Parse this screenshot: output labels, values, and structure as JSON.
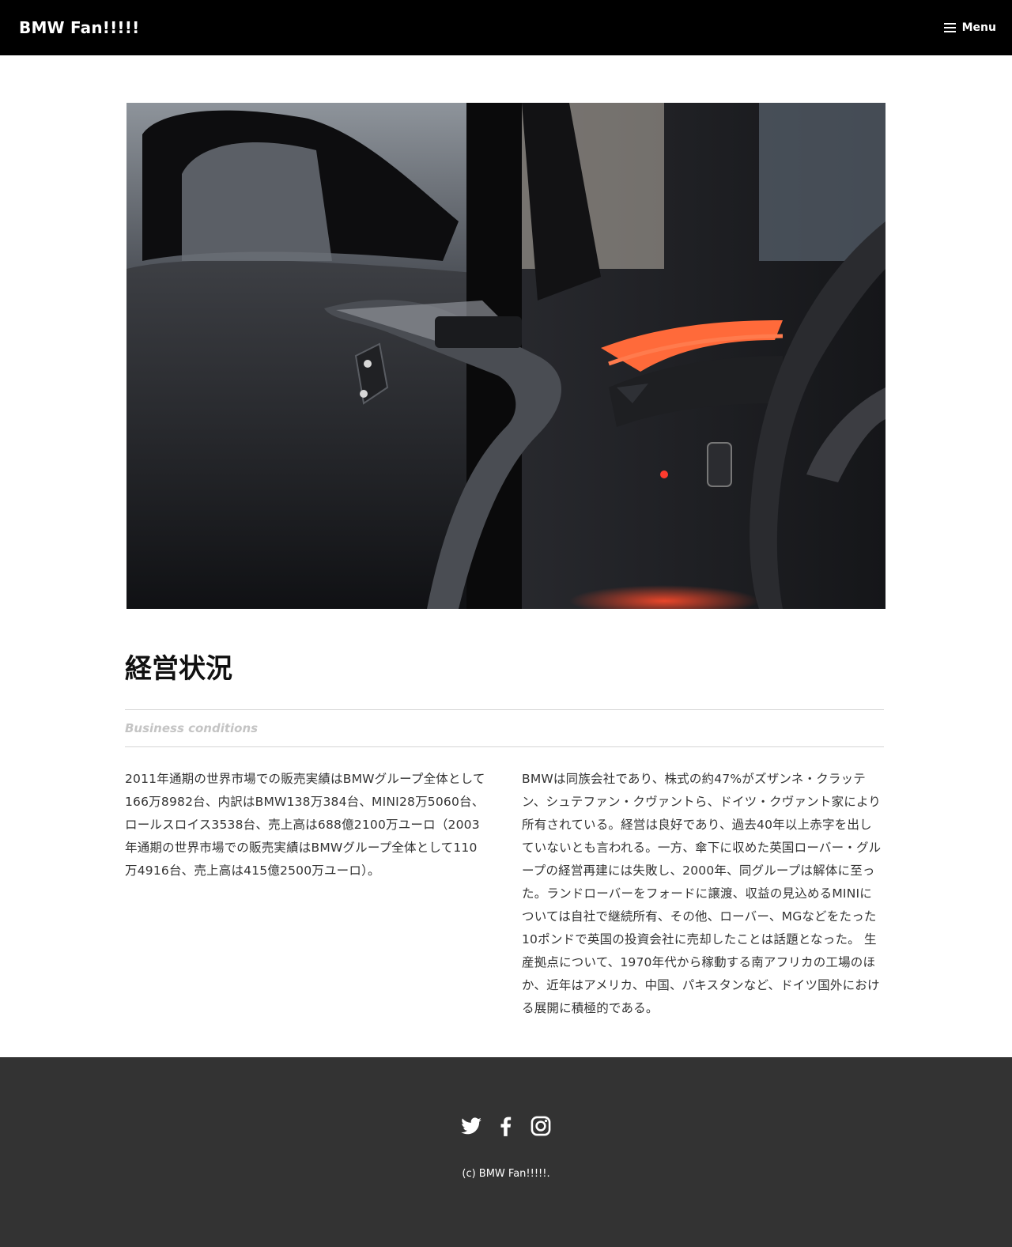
{
  "header": {
    "site_title": "BMW Fan!!!!!",
    "menu_icon": "hamburger-icon",
    "menu_label": "Menu"
  },
  "hero_image": {
    "subject": "car-interior-photo"
  },
  "post": {
    "title": "経営状況",
    "subtitle": "Business conditions",
    "column_left": "2011年通期の世界市場での販売実績はBMWグループ全体として166万8982台、内訳はBMW138万384台、MINI28万5060台、ロールスロイス3538台、売上高は688億2100万ユーロ（2003年通期の世界市場での販売実績はBMWグループ全体として110万4916台、売上高は415億2500万ユーロ）。",
    "column_right": "BMWは同族会社であり、株式の約47%がズザンネ・クラッテン、シュテファン・クヴァントら、ドイツ・クヴァント家により所有されている。経営は良好であり、過去40年以上赤字を出していないとも言われる。一方、傘下に収めた英国ローバー・グループの経営再建には失敗し、2000年、同グループは解体に至った。ランドローバーをフォードに譲渡、収益の見込めるMINIについては自社で継続所有、その他、ローバー、MGなどをたった10ポンドで英国の投資会社に売却したことは話題となった。 生産拠点について、1970年代から稼動する南アフリカの工場のほか、近年はアメリカ、中国、パキスタンなど、ドイツ国外における展開に積極的である。"
  },
  "footer": {
    "social": [
      {
        "icon": "twitter-icon"
      },
      {
        "icon": "facebook-icon"
      },
      {
        "icon": "instagram-icon"
      }
    ],
    "copyright": "(c) BMW Fan!!!!!."
  },
  "colors": {
    "header_bg": "#000000",
    "footer_bg": "#333333",
    "subtitle": "#c4c4c4",
    "accent_light": "#ff5a3c"
  }
}
